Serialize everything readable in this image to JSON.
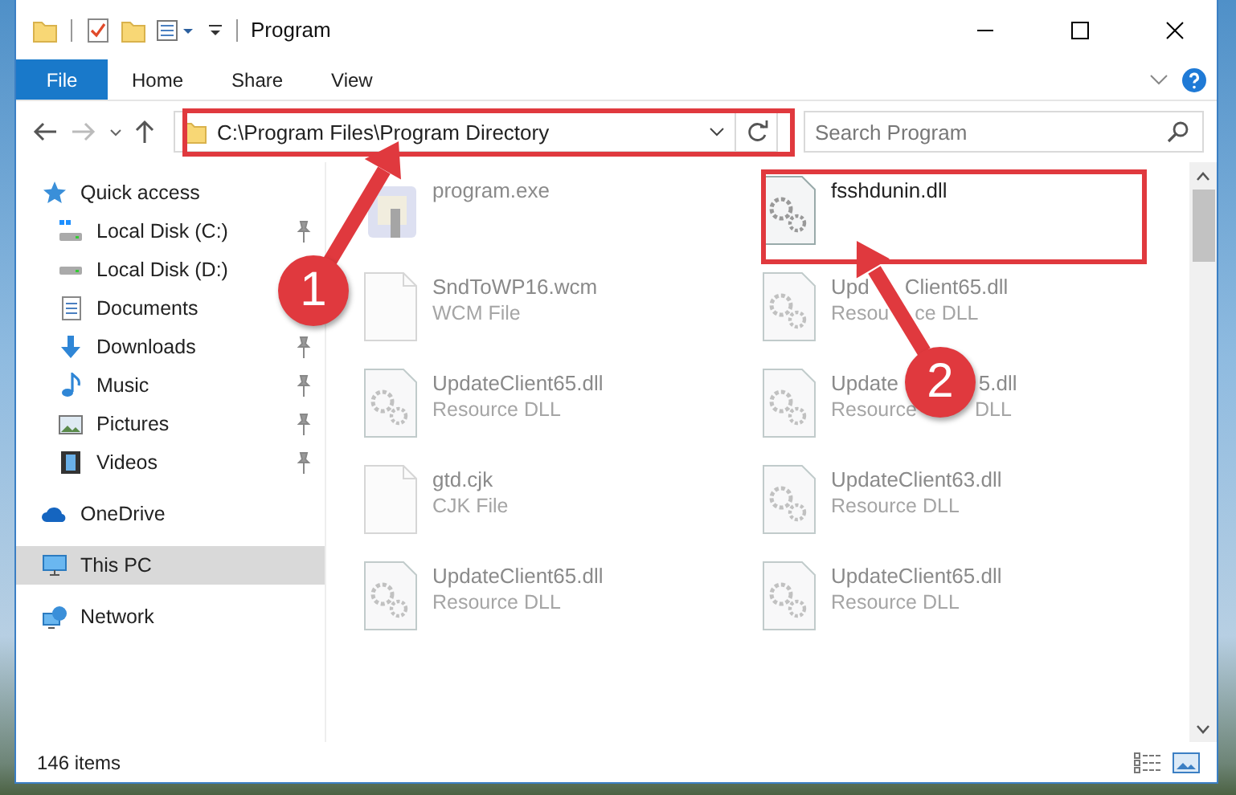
{
  "window": {
    "title": "Program"
  },
  "ribbon_tabs": [
    {
      "label": "File",
      "selected": true
    },
    {
      "label": "Home",
      "selected": false
    },
    {
      "label": "Share",
      "selected": false
    },
    {
      "label": "View",
      "selected": false
    }
  ],
  "address_bar": {
    "path": "C:\\Program Files\\Program Directory"
  },
  "search": {
    "placeholder": "Search Program"
  },
  "sidebar": {
    "items": [
      {
        "label": "Quick access",
        "kind": "star",
        "selected": false,
        "children": [
          {
            "label": "Local Disk (C:)",
            "kind": "disk-c",
            "pinned": true,
            "selected": false
          },
          {
            "label": "Local Disk (D:)",
            "kind": "disk",
            "pinned": false,
            "selected": false
          },
          {
            "label": "Documents",
            "kind": "documents",
            "pinned": false,
            "selected": false
          },
          {
            "label": "Downloads",
            "kind": "downloads",
            "pinned": true,
            "selected": false
          },
          {
            "label": "Music",
            "kind": "music",
            "pinned": true,
            "selected": false
          },
          {
            "label": "Pictures",
            "kind": "pictures",
            "pinned": true,
            "selected": false
          },
          {
            "label": "Videos",
            "kind": "videos",
            "pinned": true,
            "selected": false
          }
        ]
      },
      {
        "label": "OneDrive",
        "kind": "cloud",
        "selected": false
      },
      {
        "label": "This PC",
        "kind": "pc",
        "selected": true
      },
      {
        "label": "Network",
        "kind": "network",
        "selected": false
      }
    ]
  },
  "file_rows": [
    [
      {
        "name": "program.exe",
        "kind": "exe",
        "dimmed": true
      },
      {
        "name": "fsshdunin.dll",
        "kind": "dll",
        "dimmed": false
      }
    ],
    [
      {
        "name": "SndToWP16.wcm",
        "type": "WCM File",
        "kind": "file",
        "dimmed": true
      },
      {
        "name": [
          "Upd",
          "Client65.dll"
        ],
        "type": [
          "Resou",
          "ce DLL"
        ],
        "kind": "dll",
        "dimmed": true
      }
    ],
    [
      {
        "name": "UpdateClient65.dll",
        "type": "Resource DLL",
        "kind": "dll",
        "dimmed": true
      },
      {
        "name": [
          "Update",
          "5.dll"
        ],
        "type": [
          "Resource",
          "DLL"
        ],
        "kind": "dll",
        "dimmed": true
      }
    ],
    [
      {
        "name": "gtd.cjk",
        "type": "CJK File",
        "kind": "file",
        "dimmed": true
      },
      {
        "name": "UpdateClient63.dll",
        "type": "Resource DLL",
        "kind": "dll",
        "dimmed": true
      }
    ],
    [
      {
        "name": "UpdateClient65.dll",
        "type": "Resource DLL",
        "kind": "dll",
        "dimmed": true
      },
      {
        "name": "UpdateClient65.dll",
        "type": "Resource DLL",
        "kind": "dll",
        "dimmed": true
      }
    ]
  ],
  "status_bar": {
    "count": "146 items"
  },
  "annotations": [
    {
      "number": "1"
    },
    {
      "number": "2"
    }
  ]
}
